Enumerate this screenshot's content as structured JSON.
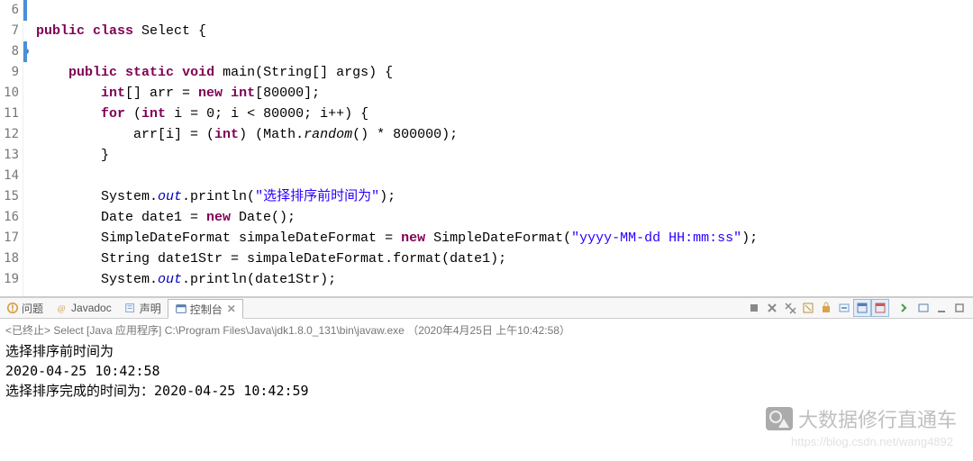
{
  "editor": {
    "lines": [
      6,
      7,
      8,
      9,
      10,
      11,
      12,
      13,
      14,
      15,
      16,
      17,
      18,
      19
    ],
    "code": {
      "l6_pre": "",
      "l6_kw1": "public",
      "l6_sp": " ",
      "l6_kw2": "class",
      "l6_after": " Select {",
      "l8_pre": "    ",
      "l8_kw1": "public",
      "l8_sp1": " ",
      "l8_kw2": "static",
      "l8_sp2": " ",
      "l8_kw3": "void",
      "l8_after": " main(String[] args) {",
      "l9_pre": "        ",
      "l9_kw": "int",
      "l9_mid": "[] arr = ",
      "l9_kw2": "new",
      "l9_sp": " ",
      "l9_kw3": "int",
      "l9_after": "[80000];",
      "l10_pre": "        ",
      "l10_kw1": "for",
      "l10_mid": " (",
      "l10_kw2": "int",
      "l10_after": " i = 0; i < 80000; i++) {",
      "l11_pre": "            arr[i] = (",
      "l11_kw": "int",
      "l11_mid": ") (Math.",
      "l11_mth": "random",
      "l11_after": "() * 800000);",
      "l12": "        }",
      "l14_pre": "        System.",
      "l14_fld": "out",
      "l14_mid": ".println(",
      "l14_str": "\"选择排序前时间为\"",
      "l14_after": ");",
      "l15_pre": "        Date date1 = ",
      "l15_kw": "new",
      "l15_after": " Date();",
      "l16_pre": "        SimpleDateFormat simpaleDateFormat = ",
      "l16_kw": "new",
      "l16_mid": " SimpleDateFormat(",
      "l16_str": "\"yyyy-MM-dd HH:mm:ss\"",
      "l16_after": ");",
      "l17": "        String date1Str = simpaleDateFormat.format(date1);",
      "l18_pre": "        System.",
      "l18_fld": "out",
      "l18_after": ".println(date1Str);"
    }
  },
  "tabs": {
    "problems": "问题",
    "javadoc": "Javadoc",
    "declaration": "声明",
    "console": "控制台"
  },
  "console": {
    "status": "<已终止> Select [Java 应用程序] C:\\Program Files\\Java\\jdk1.8.0_131\\bin\\javaw.exe （2020年4月25日 上午10:42:58）",
    "out1": "选择排序前时间为",
    "out2": "2020-04-25 10:42:58",
    "out3": "选择排序完成的时间为：2020-04-25 10:42:59"
  },
  "watermark": {
    "text": "大数据修行直通车",
    "url": "https://blog.csdn.net/wang4892"
  }
}
